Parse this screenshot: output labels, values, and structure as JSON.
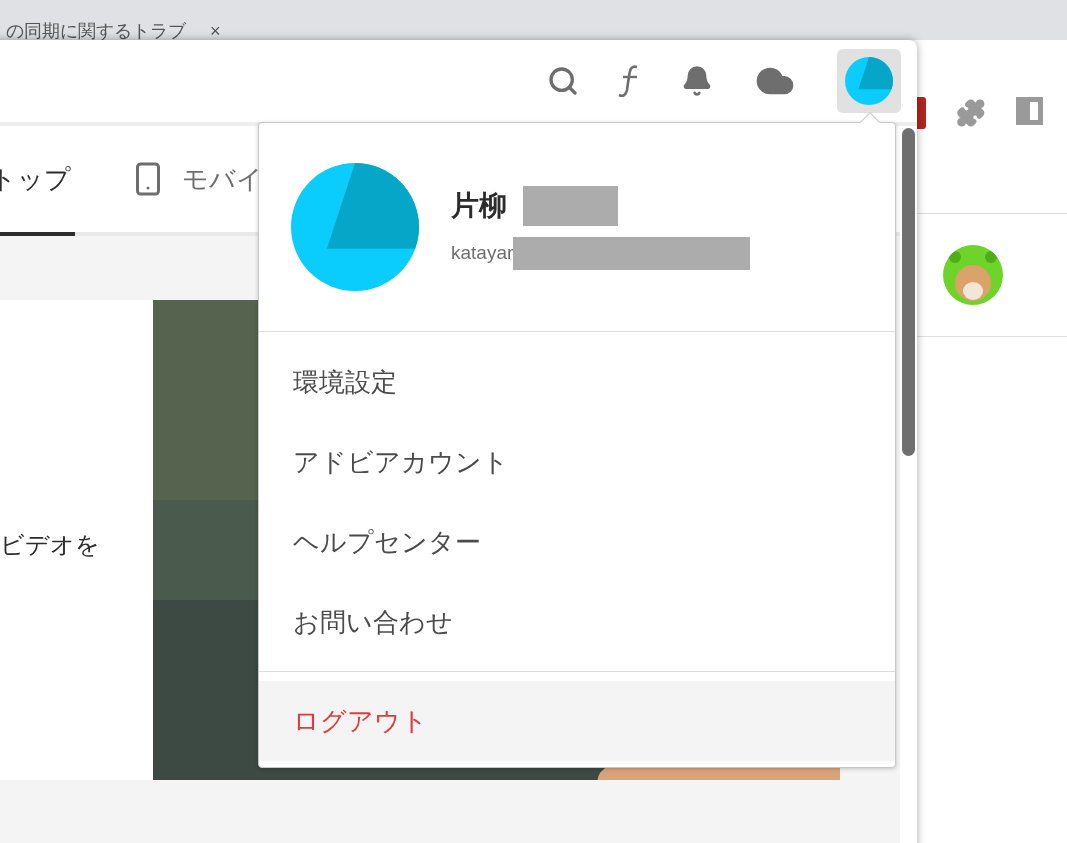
{
  "browser": {
    "tab_title": "の同期に関するトラブ",
    "tab_close": "×"
  },
  "app": {
    "account_button": {
      "menu_open": true
    },
    "tabs": [
      {
        "label": "トップ",
        "selected": true
      },
      {
        "label": "モバイ",
        "selected": false
      }
    ],
    "card": {
      "text": "ビデオを"
    }
  },
  "account_menu": {
    "name": "片柳",
    "email": "katayar",
    "items": [
      {
        "label": "環境設定",
        "kind": "normal"
      },
      {
        "label": "アドビアカウント",
        "kind": "normal"
      },
      {
        "label": "ヘルプセンター",
        "kind": "normal"
      },
      {
        "label": "お問い合わせ",
        "kind": "normal"
      },
      {
        "label": "ログアウト",
        "kind": "danger"
      }
    ]
  }
}
